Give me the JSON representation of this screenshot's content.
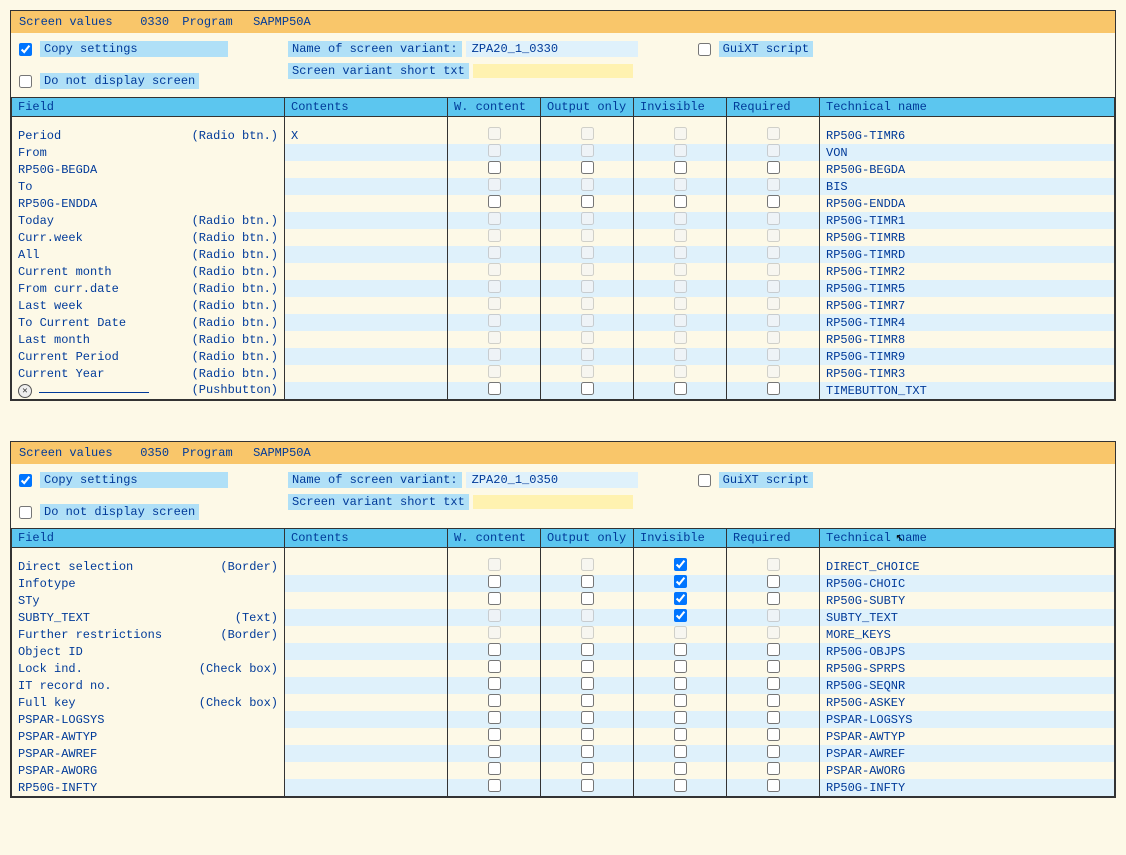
{
  "labels": {
    "screen_values": "Screen values",
    "program": "Program",
    "copy_settings": "Copy settings",
    "do_not_display": "Do not display screen",
    "name_of_variant": "Name of screen variant:",
    "short_txt": "Screen variant short txt",
    "guixt_script": "GuiXT script"
  },
  "headers": {
    "field": "Field",
    "contents": "Contents",
    "wcontent": "W. content",
    "output_only": "Output only",
    "invisible": "Invisible",
    "required": "Required",
    "technical": "Technical name"
  },
  "panels": [
    {
      "screen_num": "0330",
      "program": "SAPMP50A",
      "copy_checked": true,
      "variant_name": "ZPA20_1_0330",
      "rows": [
        {
          "field": "Period",
          "type": "(Radio btn.)",
          "contents": "X",
          "cb": {
            "wc": "g",
            "oo": "g",
            "inv": "g",
            "req": "g"
          },
          "tech": "RP50G-TIMR6",
          "alt": false
        },
        {
          "field": "From",
          "type": "",
          "contents": "",
          "cb": {
            "wc": "g",
            "oo": "g",
            "inv": "g",
            "req": "g"
          },
          "tech": "VON",
          "alt": true
        },
        {
          "field": "RP50G-BEGDA",
          "type": "",
          "contents": "",
          "cb": {
            "wc": "w",
            "oo": "w",
            "inv": "w",
            "req": "w"
          },
          "tech": "RP50G-BEGDA",
          "alt": false
        },
        {
          "field": "To",
          "type": "",
          "contents": "",
          "cb": {
            "wc": "g",
            "oo": "g",
            "inv": "g",
            "req": "g"
          },
          "tech": "BIS",
          "alt": true
        },
        {
          "field": "RP50G-ENDDA",
          "type": "",
          "contents": "",
          "cb": {
            "wc": "w",
            "oo": "w",
            "inv": "w",
            "req": "w"
          },
          "tech": "RP50G-ENDDA",
          "alt": false
        },
        {
          "field": "Today",
          "type": "(Radio btn.)",
          "contents": "",
          "cb": {
            "wc": "g",
            "oo": "g",
            "inv": "g",
            "req": "g"
          },
          "tech": "RP50G-TIMR1",
          "alt": true
        },
        {
          "field": "Curr.week",
          "type": "(Radio btn.)",
          "contents": "",
          "cb": {
            "wc": "g",
            "oo": "g",
            "inv": "g",
            "req": "g"
          },
          "tech": "RP50G-TIMRB",
          "alt": false
        },
        {
          "field": "All",
          "type": "(Radio btn.)",
          "contents": "",
          "cb": {
            "wc": "g",
            "oo": "g",
            "inv": "g",
            "req": "g"
          },
          "tech": "RP50G-TIMRD",
          "alt": true
        },
        {
          "field": "Current month",
          "type": "(Radio btn.)",
          "contents": "",
          "cb": {
            "wc": "g",
            "oo": "g",
            "inv": "g",
            "req": "g"
          },
          "tech": "RP50G-TIMR2",
          "alt": false
        },
        {
          "field": "From curr.date",
          "type": "(Radio btn.)",
          "contents": "",
          "cb": {
            "wc": "g",
            "oo": "g",
            "inv": "g",
            "req": "g"
          },
          "tech": "RP50G-TIMR5",
          "alt": true
        },
        {
          "field": "Last week",
          "type": "(Radio btn.)",
          "contents": "",
          "cb": {
            "wc": "g",
            "oo": "g",
            "inv": "g",
            "req": "g"
          },
          "tech": "RP50G-TIMR7",
          "alt": false
        },
        {
          "field": "To Current Date",
          "type": "(Radio btn.)",
          "contents": "",
          "cb": {
            "wc": "g",
            "oo": "g",
            "inv": "g",
            "req": "g"
          },
          "tech": "RP50G-TIMR4",
          "alt": true
        },
        {
          "field": "Last month",
          "type": "(Radio btn.)",
          "contents": "",
          "cb": {
            "wc": "g",
            "oo": "g",
            "inv": "g",
            "req": "g"
          },
          "tech": "RP50G-TIMR8",
          "alt": false
        },
        {
          "field": "Current Period",
          "type": "(Radio btn.)",
          "contents": "",
          "cb": {
            "wc": "g",
            "oo": "g",
            "inv": "g",
            "req": "g"
          },
          "tech": "RP50G-TIMR9",
          "alt": true
        },
        {
          "field": "Current Year",
          "type": "(Radio btn.)",
          "contents": "",
          "cb": {
            "wc": "g",
            "oo": "g",
            "inv": "g",
            "req": "g"
          },
          "tech": "RP50G-TIMR3",
          "alt": false
        },
        {
          "field": "__pushbutton__",
          "type": "(Pushbutton)",
          "contents": "",
          "cb": {
            "wc": "w",
            "oo": "w",
            "inv": "w",
            "req": "w"
          },
          "tech": "TIMEBUTTON_TXT",
          "alt": true
        }
      ]
    },
    {
      "screen_num": "0350",
      "program": "SAPMP50A",
      "copy_checked": true,
      "variant_name": "ZPA20_1_0350",
      "cursor": true,
      "rows": [
        {
          "field": "Direct selection",
          "type": "(Border)",
          "contents": "",
          "cb": {
            "wc": "g",
            "oo": "g",
            "inv": "c",
            "req": "g"
          },
          "tech": "DIRECT_CHOICE",
          "alt": false
        },
        {
          "field": "Infotype",
          "type": "",
          "contents": "",
          "cb": {
            "wc": "w",
            "oo": "w",
            "inv": "c",
            "req": "w"
          },
          "tech": "RP50G-CHOIC",
          "alt": true
        },
        {
          "field": "STy",
          "type": "",
          "contents": "",
          "cb": {
            "wc": "w",
            "oo": "w",
            "inv": "c",
            "req": "w"
          },
          "tech": "RP50G-SUBTY",
          "alt": false
        },
        {
          "field": "SUBTY_TEXT",
          "type": "(Text)",
          "contents": "",
          "cb": {
            "wc": "g",
            "oo": "g",
            "inv": "c",
            "req": "g"
          },
          "tech": "SUBTY_TEXT",
          "alt": true
        },
        {
          "field": "Further restrictions",
          "type": "(Border)",
          "contents": "",
          "cb": {
            "wc": "g",
            "oo": "g",
            "inv": "g",
            "req": "g"
          },
          "tech": "MORE_KEYS",
          "alt": false
        },
        {
          "field": "Object ID",
          "type": "",
          "contents": "",
          "cb": {
            "wc": "w",
            "oo": "w",
            "inv": "w",
            "req": "w"
          },
          "tech": "RP50G-OBJPS",
          "alt": true
        },
        {
          "field": "Lock ind.",
          "type": "(Check box)",
          "contents": "",
          "cb": {
            "wc": "w",
            "oo": "w",
            "inv": "w",
            "req": "w"
          },
          "tech": "RP50G-SPRPS",
          "alt": false
        },
        {
          "field": "IT record no.",
          "type": "",
          "contents": "",
          "cb": {
            "wc": "w",
            "oo": "w",
            "inv": "w",
            "req": "w"
          },
          "tech": "RP50G-SEQNR",
          "alt": true
        },
        {
          "field": "Full key",
          "type": "(Check box)",
          "contents": "",
          "cb": {
            "wc": "w",
            "oo": "w",
            "inv": "w",
            "req": "w"
          },
          "tech": "RP50G-ASKEY",
          "alt": false
        },
        {
          "field": "PSPAR-LOGSYS",
          "type": "",
          "contents": "",
          "cb": {
            "wc": "w",
            "oo": "w",
            "inv": "w",
            "req": "w"
          },
          "tech": "PSPAR-LOGSYS",
          "alt": true
        },
        {
          "field": "PSPAR-AWTYP",
          "type": "",
          "contents": "",
          "cb": {
            "wc": "w",
            "oo": "w",
            "inv": "w",
            "req": "w"
          },
          "tech": "PSPAR-AWTYP",
          "alt": false
        },
        {
          "field": "PSPAR-AWREF",
          "type": "",
          "contents": "",
          "cb": {
            "wc": "w",
            "oo": "w",
            "inv": "w",
            "req": "w"
          },
          "tech": "PSPAR-AWREF",
          "alt": true
        },
        {
          "field": "PSPAR-AWORG",
          "type": "",
          "contents": "",
          "cb": {
            "wc": "w",
            "oo": "w",
            "inv": "w",
            "req": "w"
          },
          "tech": "PSPAR-AWORG",
          "alt": false
        },
        {
          "field": "RP50G-INFTY",
          "type": "",
          "contents": "",
          "cb": {
            "wc": "w",
            "oo": "w",
            "inv": "w",
            "req": "w"
          },
          "tech": "RP50G-INFTY",
          "alt": true
        }
      ]
    }
  ]
}
